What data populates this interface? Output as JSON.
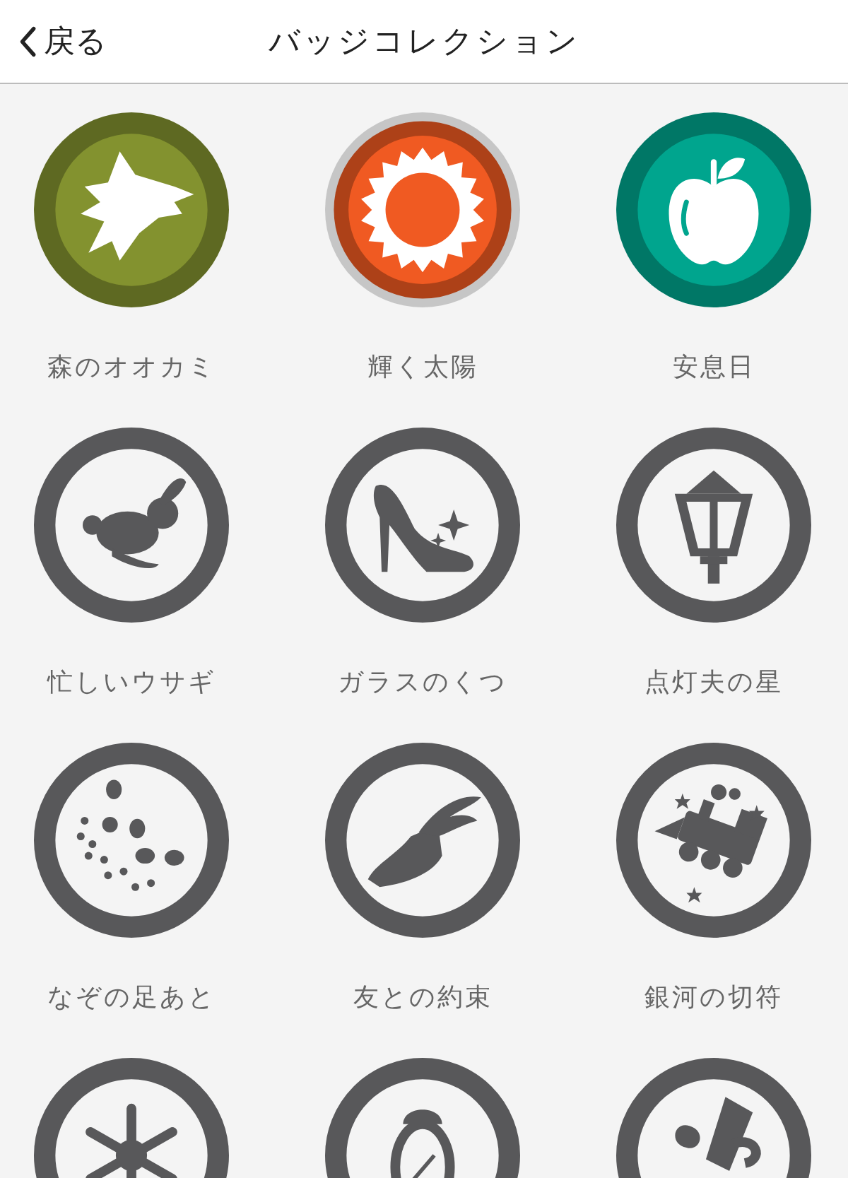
{
  "header": {
    "back": "戻る",
    "title": "バッジコレクション"
  },
  "badges": [
    {
      "label": "森のオオカミ",
      "earned": true,
      "color": "#83922f",
      "framed": false
    },
    {
      "label": "輝く太陽",
      "earned": true,
      "color": "#f05a22",
      "framed": true
    },
    {
      "label": "安息日",
      "earned": true,
      "color": "#00a58e",
      "framed": false
    },
    {
      "label": "忙しいウサギ",
      "earned": false
    },
    {
      "label": "ガラスのくつ",
      "earned": false
    },
    {
      "label": "点灯夫の星",
      "earned": false
    },
    {
      "label": "なぞの足あと",
      "earned": false
    },
    {
      "label": "友との約束",
      "earned": false
    },
    {
      "label": "銀河の切符",
      "earned": false
    },
    {
      "earned": false
    },
    {
      "earned": false
    },
    {
      "earned": false
    }
  ]
}
